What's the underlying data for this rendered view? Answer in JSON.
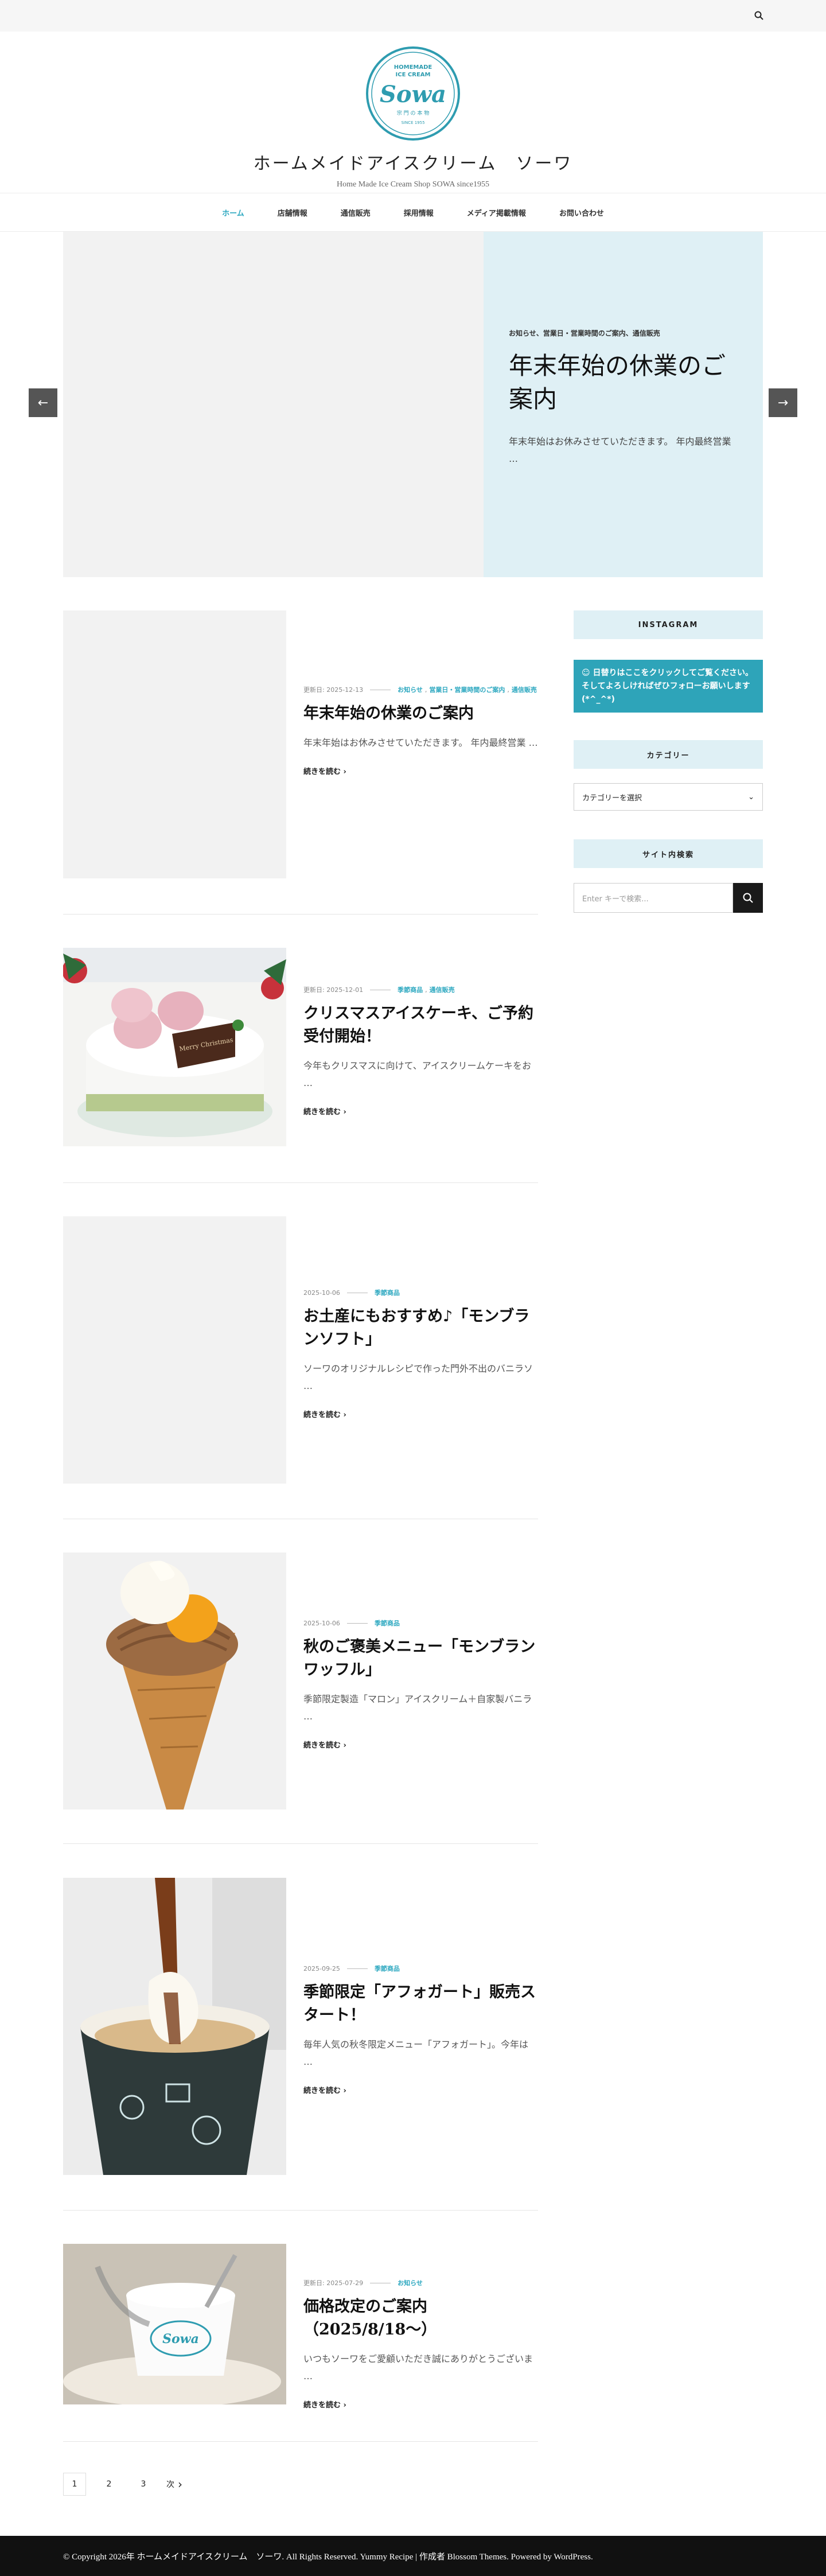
{
  "header": {
    "logo": {
      "top_text": "HOMEMADE ICE CREAM",
      "script_text": "Sowa",
      "jp_text": "宗 門 の 本 物",
      "since_text": "SINCE 1955"
    },
    "site_title": "ホームメイドアイスクリーム　ソーワ",
    "site_description": "Home Made Ice Cream Shop SOWA since1955"
  },
  "nav": {
    "items": [
      "ホーム",
      "店舗情報",
      "通信販売",
      "採用情報",
      "メディア掲載情報",
      "お問い合わせ"
    ]
  },
  "banner": {
    "categories": "お知らせ、営業日・営業時間のご案内、通信販売",
    "title": "年末年始の休業のご案内",
    "excerpt": "年末年始はお休みさせていただきます。 年内最終営業 …",
    "prev_label": "←",
    "next_label": "→"
  },
  "posts": [
    {
      "date": "更新日: 2025-12-13",
      "categories": [
        "お知らせ",
        "営業日・営業時間のご案内",
        "通信販売"
      ],
      "title": "年末年始の休業のご案内",
      "excerpt": "年末年始はお休みさせていただきます。 年内最終営業 …",
      "more": "続きを読む"
    },
    {
      "date": "更新日: 2025-12-01",
      "categories": [
        "季節商品",
        "通信販売"
      ],
      "title": "クリスマスアイスケーキ、ご予約受付開始！",
      "excerpt": "今年もクリスマスに向けて、アイスクリームケーキをお …",
      "more": "続きを読む",
      "cake_label": "Merry Christmas"
    },
    {
      "date": "2025-10-06",
      "categories": [
        "季節商品"
      ],
      "title": "お土産にもおすすめ♪「モンブランソフト」",
      "excerpt": "ソーワのオリジナルレシピで作った門外不出のバニラソ …",
      "more": "続きを読む"
    },
    {
      "date": "2025-10-06",
      "categories": [
        "季節商品"
      ],
      "title": "秋のご褒美メニュー「モンブランワッフル」",
      "excerpt": "季節限定製造「マロン」アイスクリーム＋自家製バニラ …",
      "more": "続きを読む"
    },
    {
      "date": "2025-09-25",
      "categories": [
        "季節商品"
      ],
      "title": "季節限定「アフォガート」販売スタート！",
      "excerpt": "毎年人気の秋冬限定メニュー「アフォガート」。今年は …",
      "more": "続きを読む"
    },
    {
      "date": "更新日: 2025-07-29",
      "categories": [
        "お知らせ"
      ],
      "title": "価格改定のご案内（2025/8/18〜）",
      "excerpt": "いつもソーワをご愛顧いただき誠にありがとうございま …",
      "more": "続きを読む"
    }
  ],
  "sidebar": {
    "instagram_title": "INSTAGRAM",
    "instagram_text": "☺ 日替りはここをクリックしてご覧ください。そしてよろしければぜひフォローお願いします(*^_^*)",
    "category_title": "カテゴリー",
    "category_select": "カテゴリーを選択",
    "search_title": "サイト内検索",
    "search_placeholder": "Enter キーで検索..."
  },
  "pagination": {
    "pages": [
      "1",
      "2",
      "3"
    ],
    "next_label": "次"
  },
  "footer": {
    "text": "© Copyright 2026年 ホームメイドアイスクリーム　ソーワ. All Rights Reserved. Yummy Recipe | 作成者 Blossom Themes. Powered by WordPress."
  },
  "colors": {
    "accent": "#2da8c0",
    "panel": "#dff0f5",
    "instagram_box": "#2ea4b9",
    "footer": "#111111"
  }
}
